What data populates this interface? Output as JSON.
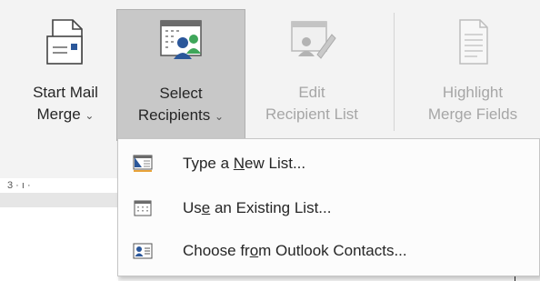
{
  "ribbon": {
    "start_mail_merge": {
      "line1": "Start Mail",
      "line2": "Merge",
      "chevron": "⌄",
      "icon": "document-envelope-icon"
    },
    "select_recipients": {
      "line1": "Select",
      "line2": "Recipients",
      "chevron": "⌄",
      "icon": "address-book-people-icon"
    },
    "edit_recipient_list": {
      "line1": "Edit",
      "line2": "Recipient List",
      "icon": "list-edit-icon"
    },
    "highlight_merge_fields": {
      "line1": "Highlight",
      "line2": "Merge Fields",
      "icon": "document-fields-icon"
    }
  },
  "ruler": {
    "text": "3 · ı ·"
  },
  "menu": {
    "items": [
      {
        "pre": "Type a ",
        "key": "N",
        "post": "ew List...",
        "icon": "new-list-icon"
      },
      {
        "pre": "Us",
        "key": "e",
        "post": " an Existing List...",
        "icon": "existing-list-icon"
      },
      {
        "pre": "Choose fr",
        "key": "o",
        "post": "m Outlook Contacts...",
        "icon": "outlook-contacts-icon"
      }
    ]
  },
  "colors": {
    "accent_blue": "#2b579a",
    "green": "#3fa65a",
    "orange": "#e8a33a",
    "selected_bg": "#c8c8c8"
  }
}
